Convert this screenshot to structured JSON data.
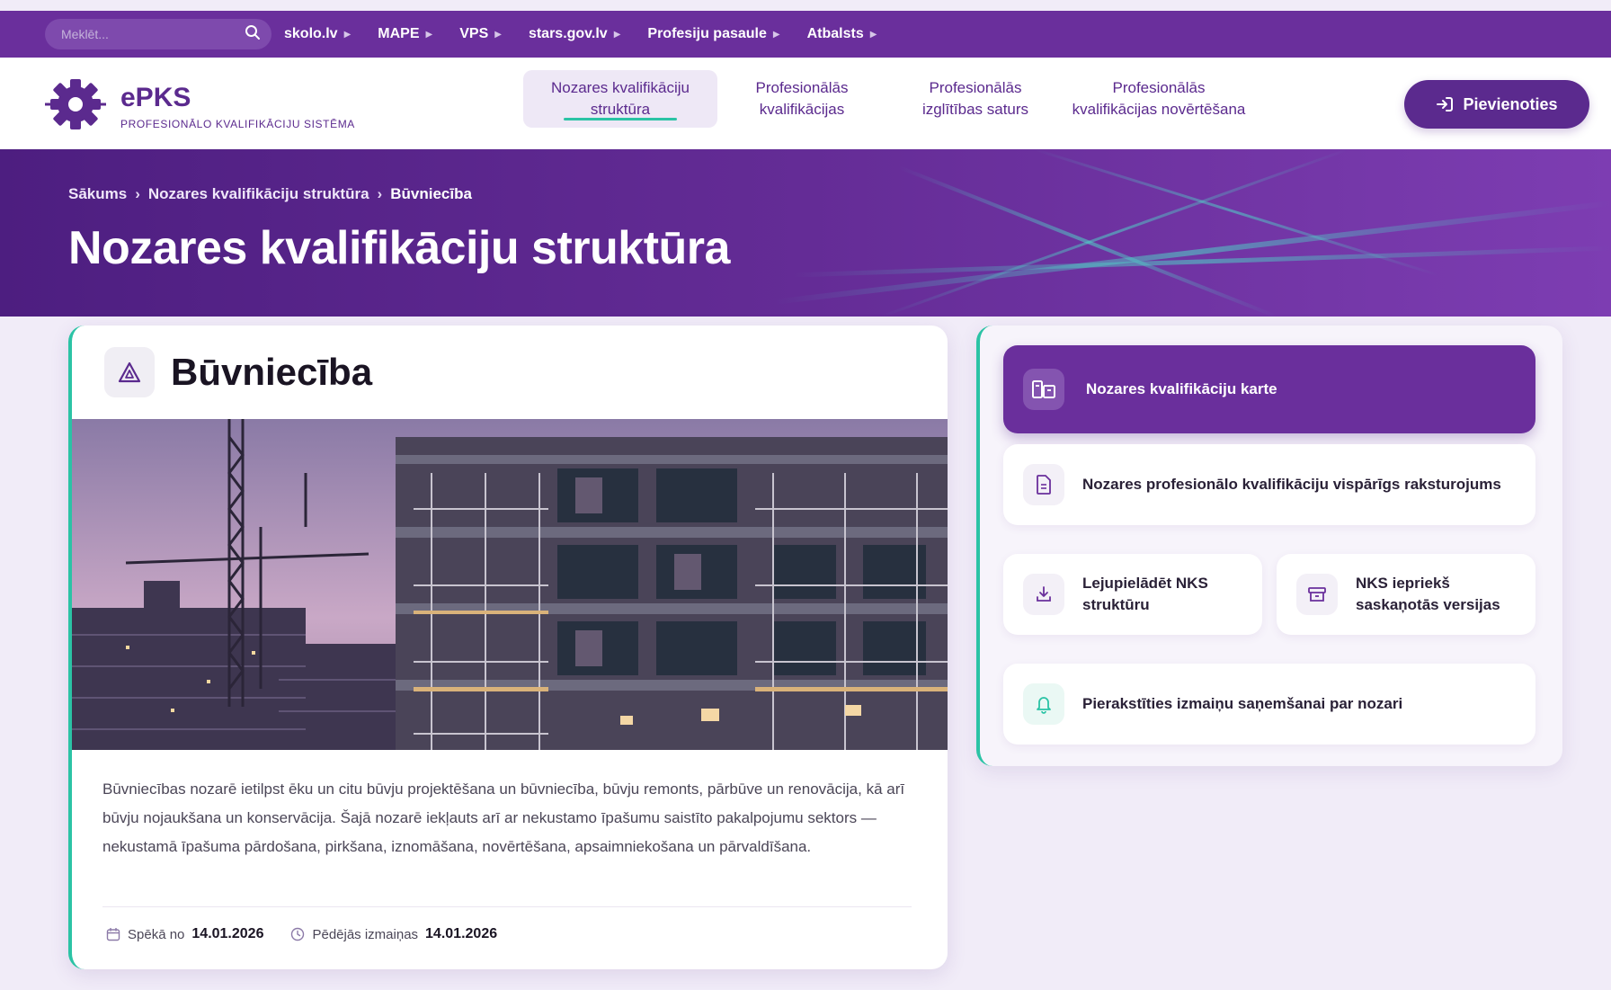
{
  "topbar": {
    "search_placeholder": "Meklēt...",
    "links": [
      "skolo.lv",
      "MAPE",
      "VPS",
      "stars.gov.lv",
      "Profesiju pasaule",
      "Atbalsts"
    ],
    "arrow": "▶"
  },
  "header": {
    "logo_title": "ePKS",
    "logo_subtitle": "PROFESIONĀLO KVALIFIKĀCIJU SISTĒMA",
    "nav": [
      {
        "line1": "Nozares kvalifikāciju",
        "line2": "struktūra"
      },
      {
        "line1": "Profesionālās",
        "line2": "kvalifikācijas"
      },
      {
        "line1": "Profesionālās",
        "line2": "izglītības saturs"
      },
      {
        "line1": "Profesionālās",
        "line2": "kvalifikācijas novērtēšana"
      }
    ],
    "login_label": "Pievienoties"
  },
  "hero": {
    "breadcrumb": [
      "Sākums",
      "Nozares kvalifikāciju struktūra",
      "Būvniecība"
    ],
    "separator": "›",
    "title": "Nozares kvalifikāciju struktūra"
  },
  "sector": {
    "title": "Būvniecība",
    "description": "Būvniecības nozarē ietilpst ēku un citu būvju projektēšana un būvniecība, būvju remonts, pārbūve un renovācija, kā arī būvju nojaukšana un konservācija. Šajā nozarē iekļauts arī ar nekustamo īpašumu saistīto pakalpojumu sektors — nekustamā īpašuma pārdošana, pirkšana, iznomāšana, novērtēšana, apsaimniekošana un pārvaldīšana.",
    "valid_from_label": "Spēkā no",
    "valid_from": "14.01.2026",
    "last_change_label": "Pēdējās izmaiņas",
    "last_change": "14.01.2026"
  },
  "panel": {
    "map_label": "Nozares kvalifikāciju karte",
    "overview_label": "Nozares profesionālo kvalifikāciju vispārīgs raksturojums",
    "download_line1": "Lejupielādēt NKS",
    "download_line2": "struktūru",
    "previous_line1": "NKS iepriekš",
    "previous_line2": "saskaņotās versijas",
    "subscribe_label": "Pierakstīties izmaiņu saņemšanai par nozari"
  },
  "colors": {
    "brand": "#6a2f9c",
    "accent": "#2bc3a5",
    "background": "#f1ecf8"
  },
  "icons": {
    "search": "search-icon",
    "logo": "gear-logo-icon",
    "login": "login-icon",
    "sector": "warning-triangle-icon",
    "map": "map-book-icon",
    "overview": "document-icon",
    "download": "download-icon",
    "archive": "archive-icon",
    "bell": "bell-icon",
    "calendar": "calendar-icon",
    "clock": "clock-icon"
  }
}
